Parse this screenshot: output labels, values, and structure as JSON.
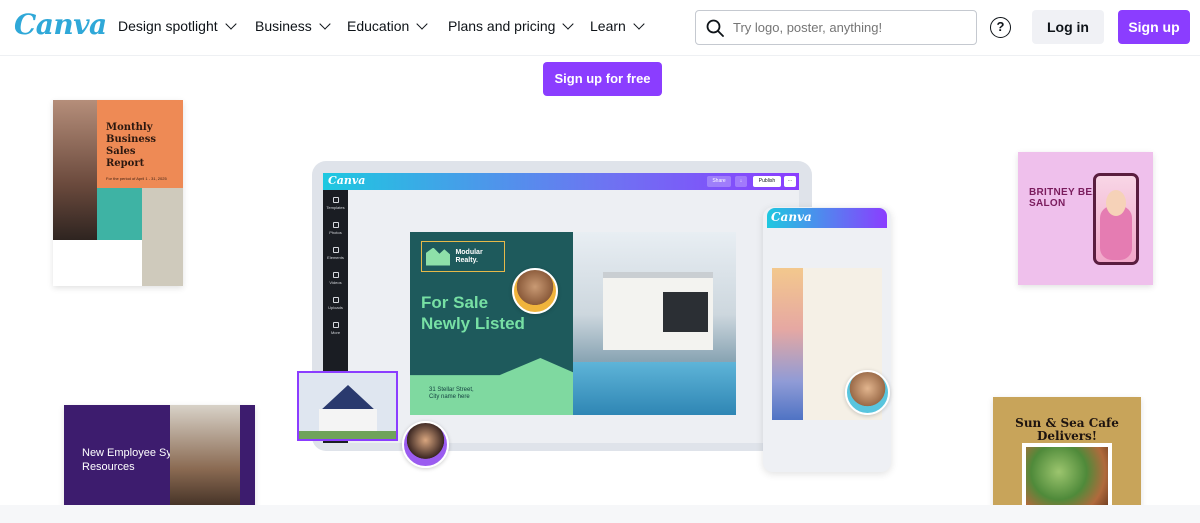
{
  "brand": {
    "logo_text": "Canva",
    "accent": "#8b3dff",
    "logo_color": "#2fa8d8"
  },
  "nav": {
    "items": [
      {
        "label": "Design spotlight"
      },
      {
        "label": "Business"
      },
      {
        "label": "Education"
      },
      {
        "label": "Plans and pricing"
      },
      {
        "label": "Learn"
      }
    ],
    "search_placeholder": "Try logo, poster, anything!",
    "help_glyph": "?",
    "login_label": "Log in",
    "signup_label": "Sign up"
  },
  "hero": {
    "cta_label": "Sign up for free"
  },
  "cards": {
    "report": {
      "title": "Monthly Business Sales Report",
      "subtitle": "For the period of April 1 - 31, 2025"
    },
    "britney": {
      "title": "BRITNEY BEAUTY & SALON"
    },
    "employee": {
      "title": "New Employee System and Resources"
    },
    "sunsea": {
      "title": "Sun & Sea Cafe Delivers!"
    }
  },
  "editor": {
    "logo_text": "Canva",
    "share_label": "Share",
    "publish_label": "Publish",
    "more_label": "···",
    "side_items": [
      {
        "label": "Templates"
      },
      {
        "label": "Photos"
      },
      {
        "label": "Elements"
      },
      {
        "label": "Videos"
      },
      {
        "label": "Uploads"
      },
      {
        "label": "More"
      }
    ],
    "listing": {
      "brand_name": "Modular Realty.",
      "headline_1": "For Sale",
      "headline_2": "Newly Listed",
      "address_1": "31 Stellar Street,",
      "address_2": "City name here"
    }
  },
  "phone": {
    "logo_text": "Canva"
  }
}
